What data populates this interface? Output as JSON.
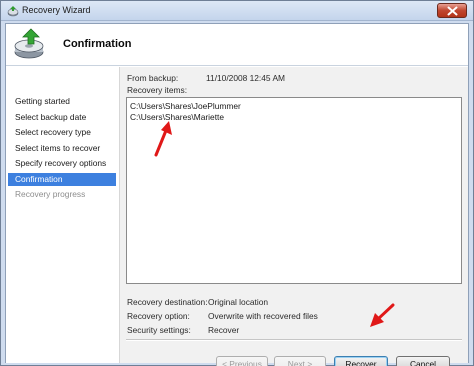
{
  "window": {
    "title": "Recovery Wizard"
  },
  "header": {
    "title": "Confirmation"
  },
  "sidebar": {
    "items": [
      {
        "label": "Getting started"
      },
      {
        "label": "Select backup date"
      },
      {
        "label": "Select recovery type"
      },
      {
        "label": "Select items to recover"
      },
      {
        "label": "Specify recovery options"
      },
      {
        "label": "Confirmation"
      },
      {
        "label": "Recovery progress"
      }
    ],
    "active_index": 5
  },
  "summary": {
    "from_backup_label": "From backup:",
    "from_backup_value": "11/10/2008 12:45 AM",
    "recovery_items_label": "Recovery items:",
    "items": [
      "C:\\Users\\Shares\\JoePlummer",
      "C:\\Users\\Shares\\Mariette"
    ],
    "destination_label": "Recovery destination:",
    "destination_value": "Original location",
    "option_label": "Recovery option:",
    "option_value": "Overwrite with recovered files",
    "security_label": "Security settings:",
    "security_value": "Recover"
  },
  "buttons": {
    "previous": "< Previous",
    "next": "Next >",
    "recover": "Recover",
    "cancel": "Cancel"
  },
  "colors": {
    "accent": "#3d80df",
    "annotation_arrow": "#e01818"
  },
  "icons": {
    "title": "backup-drive-icon",
    "header": "recovery-disk-icon",
    "close": "close-icon"
  }
}
